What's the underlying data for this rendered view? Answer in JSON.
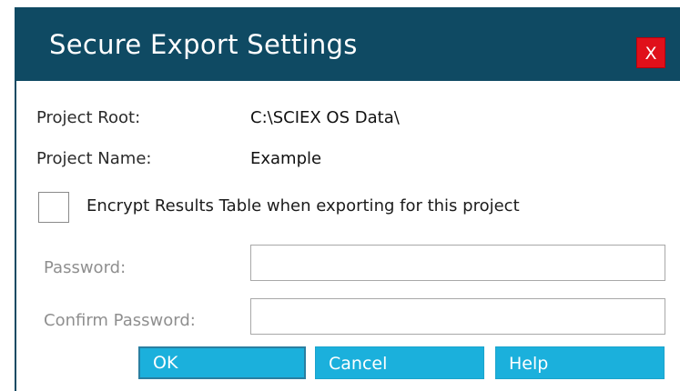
{
  "window": {
    "title": "Secure Export Settings",
    "close_label": "X"
  },
  "project": {
    "root_label": "Project Root:",
    "root_value": "C:\\SCIEX OS Data\\",
    "name_label": "Project Name:",
    "name_value": "Example"
  },
  "encrypt": {
    "label": "Encrypt Results Table when exporting for this project",
    "checked": false
  },
  "password": {
    "label": "Password:",
    "value": "",
    "confirm_label": "Confirm Password:",
    "confirm_value": ""
  },
  "buttons": {
    "ok": "OK",
    "cancel": "Cancel",
    "help": "Help"
  },
  "colors": {
    "titlebar": "#0f4a63",
    "close": "#e0101a",
    "button": "#1bb0dc"
  }
}
